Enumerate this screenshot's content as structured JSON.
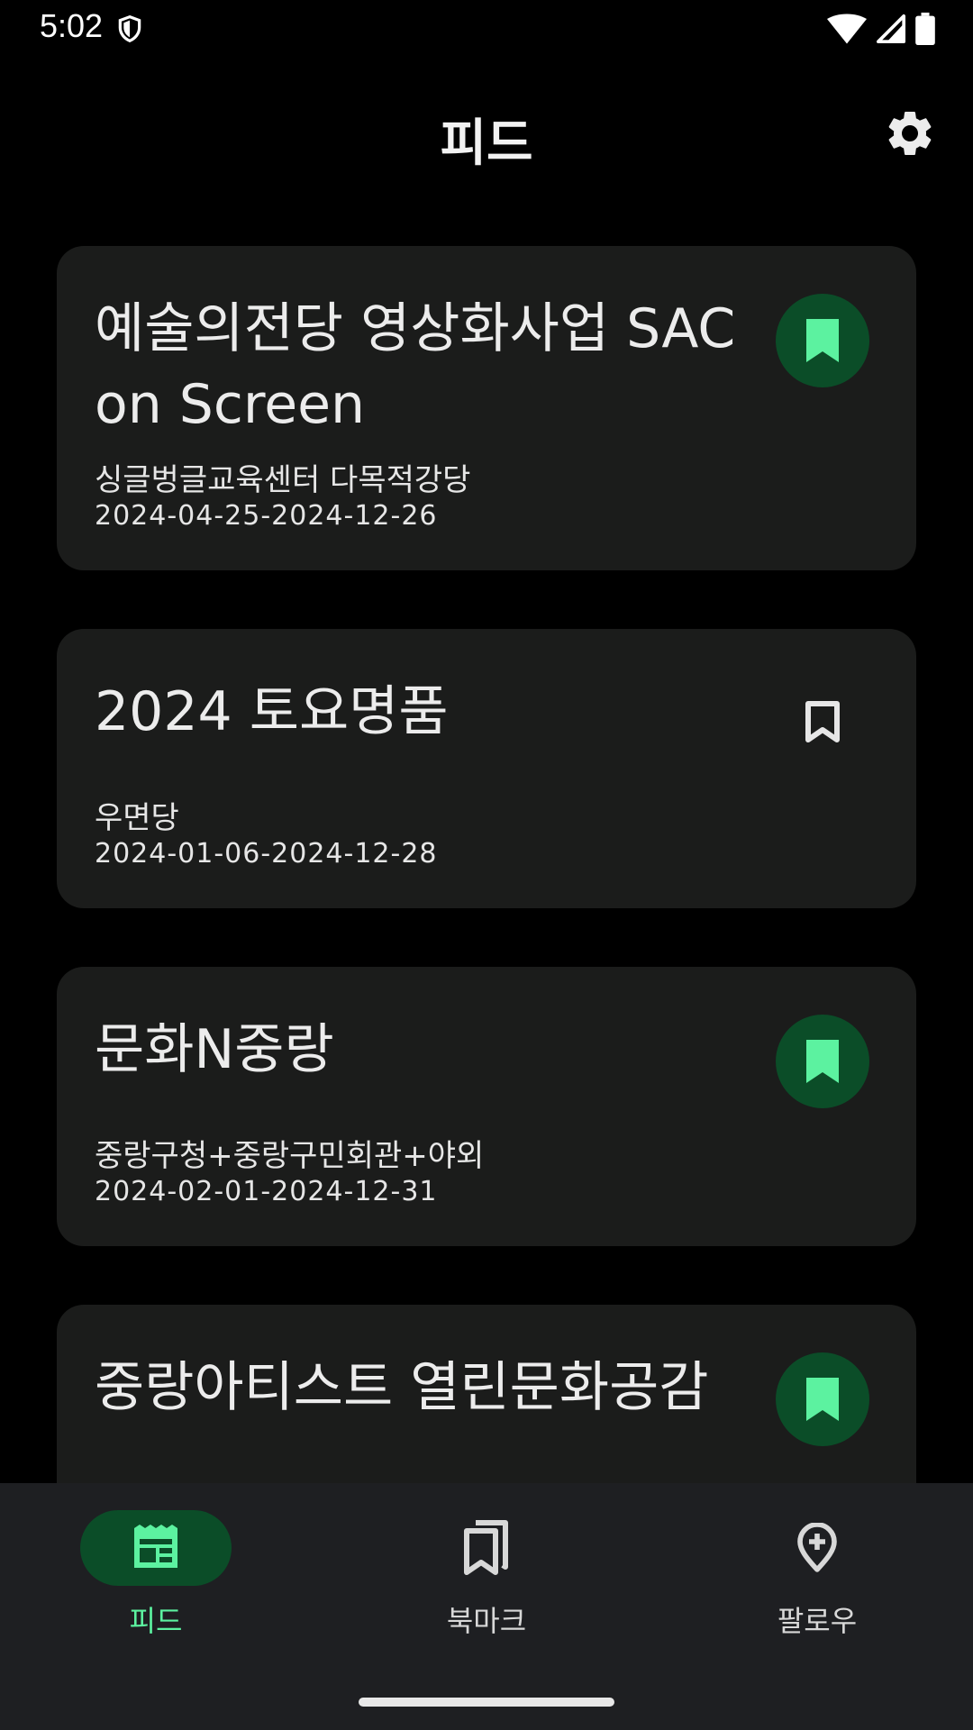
{
  "status_bar": {
    "time": "5:02",
    "icons": [
      "shield-icon",
      "wifi-icon",
      "signal-icon",
      "battery-icon"
    ]
  },
  "header": {
    "title": "피드",
    "settings_icon": "gear-icon"
  },
  "colors": {
    "background": "#000000",
    "card": "#1b1c1b",
    "accent": "#5cf2a0",
    "accent_container": "#0b4d28",
    "nav_background": "#1e1f22"
  },
  "feed": {
    "cards": [
      {
        "title": "예술의전당 영상화사업 SAC on Screen",
        "venue": "싱글벙글교육센터 다목적강당",
        "date": "2024-04-25-2024-12-26",
        "bookmarked": true
      },
      {
        "title": "2024 토요명품",
        "venue": "우면당",
        "date": "2024-01-06-2024-12-28",
        "bookmarked": false
      },
      {
        "title": "문화N중랑",
        "venue": "중랑구청+중랑구민회관+야외",
        "date": "2024-02-01-2024-12-31",
        "bookmarked": true
      },
      {
        "title": "중랑아티스트 열린문화공감",
        "venue": "",
        "date": "",
        "bookmarked": true
      }
    ]
  },
  "bottom_nav": {
    "items": [
      {
        "label": "피드",
        "icon": "feed-icon",
        "active": true
      },
      {
        "label": "북마크",
        "icon": "bookmarks-icon",
        "active": false
      },
      {
        "label": "팔로우",
        "icon": "add-location-icon",
        "active": false
      }
    ]
  }
}
